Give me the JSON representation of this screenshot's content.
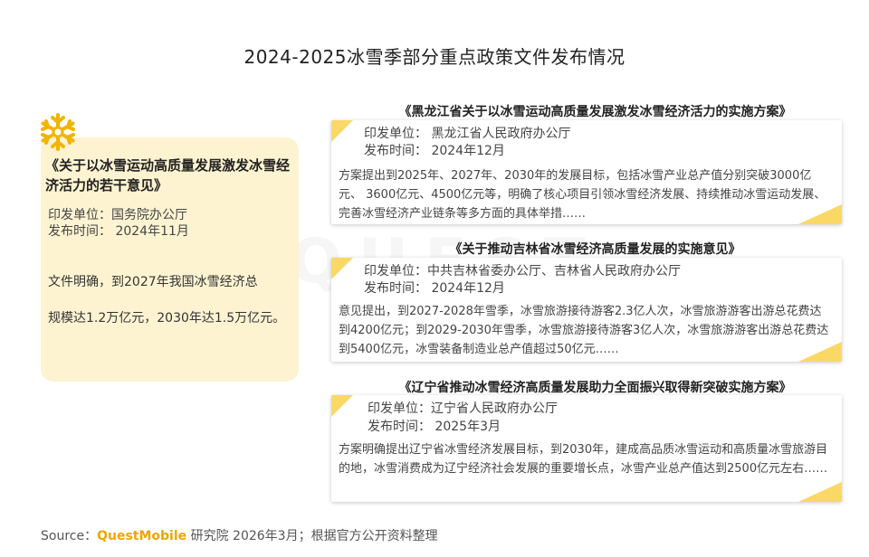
{
  "title": "2024-2025冰雪季部分重点政策文件发布情况",
  "left": {
    "icon": "snowflake-icon",
    "title": "《关于以冰雪运动高质量发展激发冰雪经济活力的若干意见》",
    "issuer": "印发单位：国务院办公厅",
    "date": "发布时间：  2024年11月",
    "body_1": "文件明确，到2027年我国冰雪经济总",
    "body_2": "规模达1.2万亿元，2030年达1.5万亿元。"
  },
  "policies": [
    {
      "title": "《黑龙江省关于以冰雪运动高质量发展激发冰雪经济活力的实施方案》",
      "issuer": "印发单位：  黑龙江省人民政府办公厅",
      "date": "发布时间：  2024年12月",
      "desc": "方案提出到2025年、2027年、2030年的发展目标，包括冰雪产业总产值分别突破3000亿元、 3600亿元、4500亿元等，明确了核心项目引领冰雪经济发展、持续推动冰雪运动发展、完善冰雪经济产业链条等多方面的具体举措……"
    },
    {
      "title": "《关于推动吉林省冰雪经济高质量发展的实施意见》",
      "issuer": "印发单位：中共吉林省委办公厅、吉林省人民政府办公厅",
      "date": "发布时间：  2024年12月",
      "desc": "意见提出，到2027-2028年雪季，冰雪旅游接待游客2.3亿人次，冰雪旅游游客出游总花费达到4200亿元；到2029-2030年雪季，冰雪旅游接待游客3亿人次，冰雪旅游游客出游总花费达到5400亿元，冰雪装备制造业总产值超过50亿元……"
    },
    {
      "title": "《辽宁省推动冰雪经济高质量发展助力全面振兴取得新突破实施方案》",
      "issuer": "印发单位：辽宁省人民政府办公厅",
      "date": "发布时间：  2025年3月",
      "desc": "方案明确提出辽宁省冰雪经济发展目标，到2030年，建成高品质冰雪运动和高质量冰雪旅游目的地，冰雪消费成为辽宁经济社会发展的重要增长点，冰雪产业总产值达到2500亿元左右……"
    }
  ],
  "source": {
    "prefix": "Source：",
    "brand": "QuestMobile",
    "suffix": " 研究院 2026年3月；根据官方公开资料整理"
  },
  "colors": {
    "accent": "#f9d866",
    "card_bg": "#fdf3d1",
    "brand": "#f0a500"
  }
}
